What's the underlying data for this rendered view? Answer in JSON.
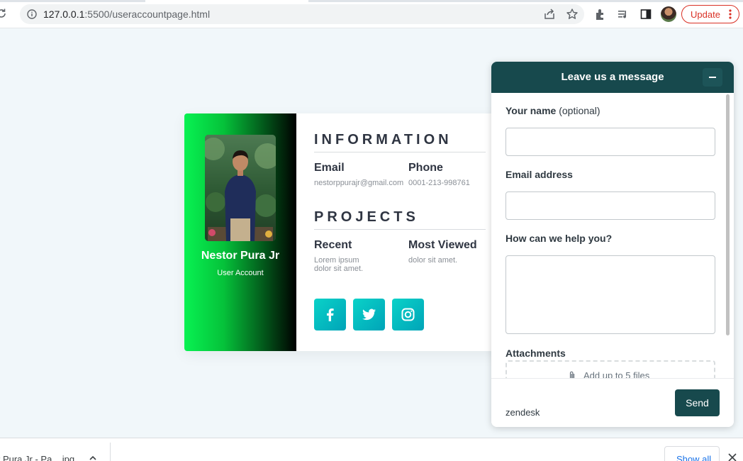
{
  "browser": {
    "url_host": "127.0.0.1",
    "url_rest": ":5500/useraccountpage.html",
    "update_label": "Update"
  },
  "profile": {
    "name": "Nestor Pura Jr",
    "role": "User Account",
    "information": {
      "title": "INFORMATION",
      "email_label": "Email",
      "email_value": "nestorppurajr@gmail.com",
      "phone_label": "Phone",
      "phone_value": "0001-213-998761"
    },
    "projects": {
      "title": "PROJECTS",
      "recent_label": "Recent",
      "recent_value_line1": "Lorem ipsum",
      "recent_value_line2": "dolor sit amet.",
      "most_viewed_label": "Most Viewed",
      "most_viewed_value": "dolor sit amet."
    },
    "social": [
      "facebook-icon",
      "twitter-icon",
      "instagram-icon"
    ],
    "gradient_colors": [
      "#08f252",
      "#000000"
    ],
    "social_color": "#00bcc8"
  },
  "widget": {
    "title": "Leave us a message",
    "name_label": "Your name",
    "name_optional": "(optional)",
    "email_label": "Email address",
    "help_label": "How can we help you?",
    "attachments_label": "Attachments",
    "dropzone_text": "Add up to 5 files",
    "brand": "zendesk",
    "send_label": "Send",
    "accent": "#17494d"
  },
  "downloads": {
    "file_label": "r Pura Jr - Pa....jpg",
    "show_all_label": "Show all"
  }
}
